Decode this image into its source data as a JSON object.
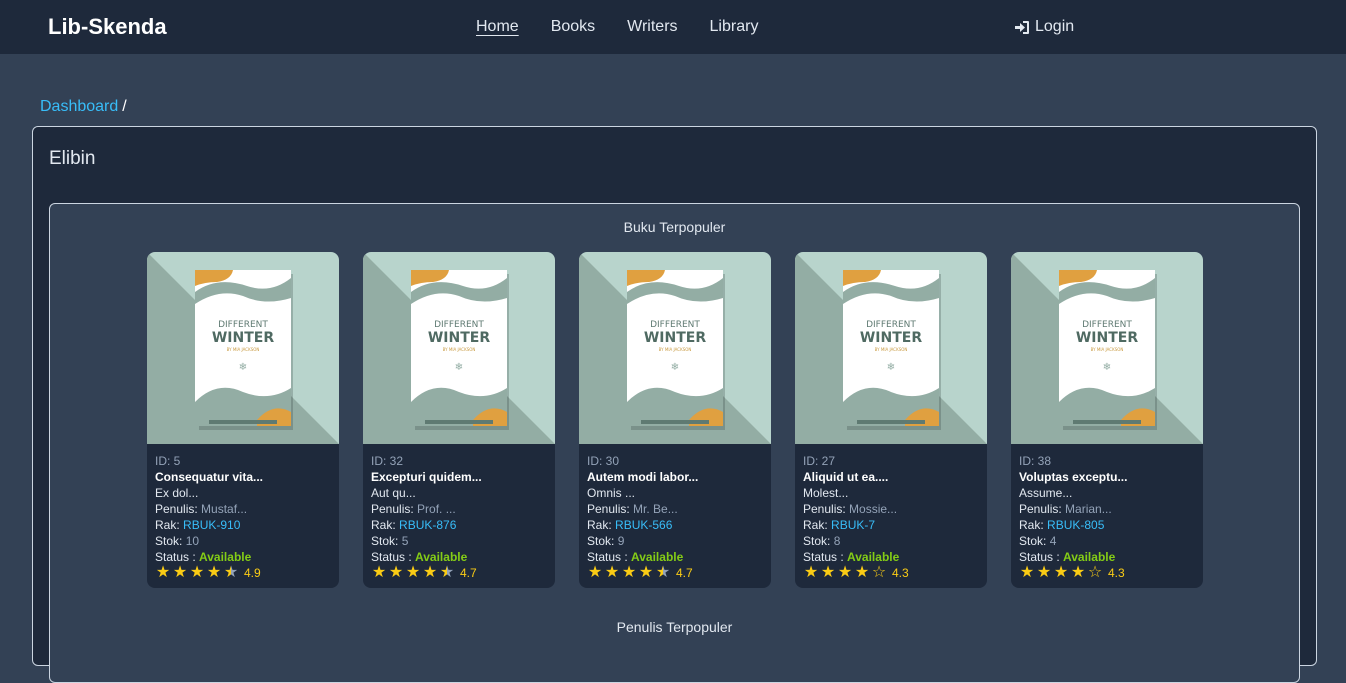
{
  "navbar": {
    "brand": "Lib-Skenda",
    "links": [
      "Home",
      "Books",
      "Writers",
      "Library"
    ],
    "login": "Login"
  },
  "breadcrumb": {
    "link": "Dashboard",
    "separator": "/"
  },
  "main": {
    "title": "Elibin",
    "popular_books_title": "Buku Terpopuler",
    "popular_writers_title": "Penulis Terpopuler"
  },
  "cover": {
    "line1": "DIFFERENT",
    "line2": "WINTER",
    "line3": "BY MIA JACKSON"
  },
  "books": [
    {
      "id": "ID: 5",
      "title": "Consequatur vita...",
      "subtitle": "Ex dol...",
      "penulis_label": "Penulis:",
      "penulis": "Mustaf...",
      "rak_label": "Rak:",
      "rak": "RBUK-910",
      "stok_label": "Stok:",
      "stok": "10",
      "status_label": "Status :",
      "status": "Available",
      "stars": [
        "full",
        "full",
        "full",
        "full",
        "half"
      ],
      "score": "4.9"
    },
    {
      "id": "ID: 32",
      "title": "Excepturi quidem...",
      "subtitle": "Aut qu...",
      "penulis_label": "Penulis:",
      "penulis": "Prof. ...",
      "rak_label": "Rak:",
      "rak": "RBUK-876",
      "stok_label": "Stok:",
      "stok": "5",
      "status_label": "Status :",
      "status": "Available",
      "stars": [
        "full",
        "full",
        "full",
        "full",
        "half"
      ],
      "score": "4.7"
    },
    {
      "id": "ID: 30",
      "title": "Autem modi labor...",
      "subtitle": "Omnis ...",
      "penulis_label": "Penulis:",
      "penulis": "Mr. Be...",
      "rak_label": "Rak:",
      "rak": "RBUK-566",
      "stok_label": "Stok:",
      "stok": "9",
      "status_label": "Status :",
      "status": "Available",
      "stars": [
        "full",
        "full",
        "full",
        "full",
        "half"
      ],
      "score": "4.7"
    },
    {
      "id": "ID: 27",
      "title": "Aliquid ut ea....",
      "subtitle": "Molest...",
      "penulis_label": "Penulis:",
      "penulis": "Mossie...",
      "rak_label": "Rak:",
      "rak": "RBUK-7",
      "stok_label": "Stok:",
      "stok": "8",
      "status_label": "Status :",
      "status": "Available",
      "stars": [
        "full",
        "full",
        "full",
        "full",
        "empty"
      ],
      "score": "4.3"
    },
    {
      "id": "ID: 38",
      "title": "Voluptas exceptu...",
      "subtitle": "Assume...",
      "penulis_label": "Penulis:",
      "penulis": "Marian...",
      "rak_label": "Rak:",
      "rak": "RBUK-805",
      "stok_label": "Stok:",
      "stok": "4",
      "status_label": "Status :",
      "status": "Available",
      "stars": [
        "full",
        "full",
        "full",
        "full",
        "empty"
      ],
      "score": "4.3"
    }
  ]
}
